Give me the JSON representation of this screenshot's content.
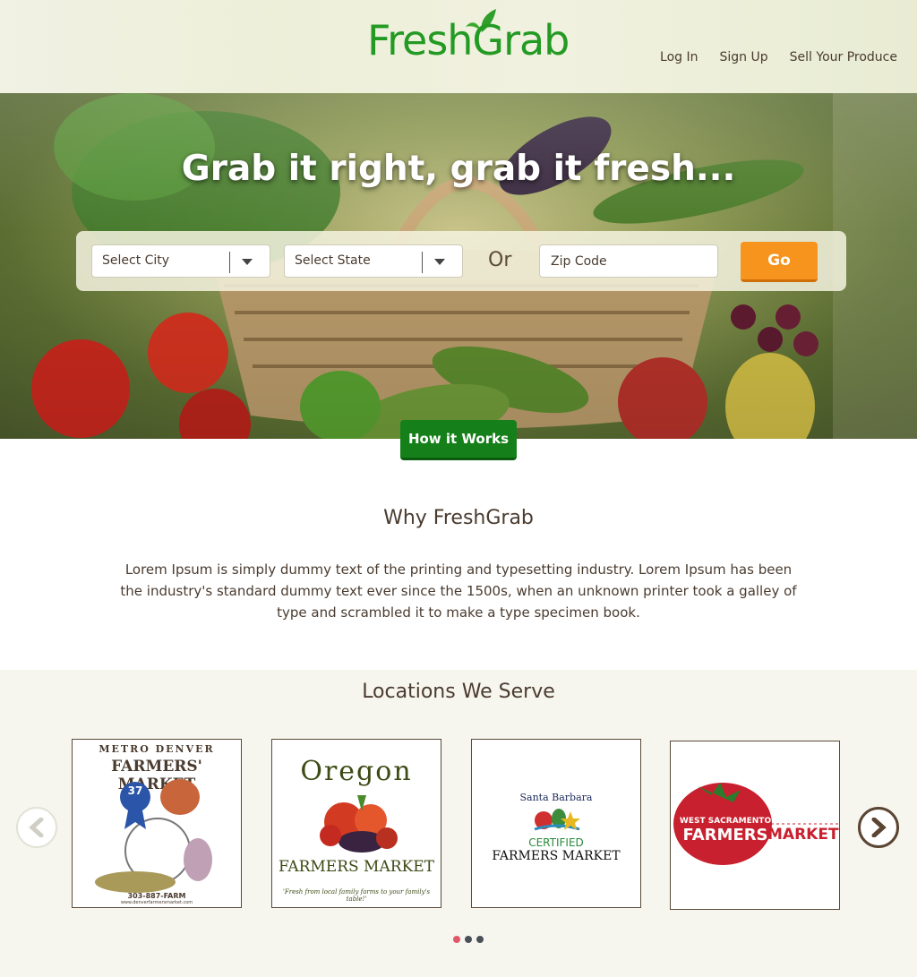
{
  "brand": {
    "logo_text": "FreshGrab",
    "color": "#239a23"
  },
  "nav": {
    "login": "Log In",
    "signup": "Sign Up",
    "sell": "Sell Your Produce"
  },
  "hero": {
    "title": "Grab it right, grab it fresh...",
    "city_select": "Select City",
    "state_select": "Select State",
    "or_text": "Or",
    "zip_placeholder": "Zip Code",
    "go_label": "Go",
    "how_label": "How it Works"
  },
  "why": {
    "title": "Why FreshGrab",
    "body": "Lorem Ipsum is simply dummy text of the printing and typesetting industry. Lorem Ipsum has been the industry's standard dummy text ever since the 1500s, when an unknown printer took a galley of type and scrambled it to make a type specimen book."
  },
  "locations": {
    "title": "Locations We Serve",
    "cards": [
      {
        "line1": "Metro Denver",
        "line2": "Farmers' Market",
        "badge": "37",
        "phone": "303-887-FARM",
        "url": "www.denverfarmersmarket.com"
      },
      {
        "line1": "Oregon",
        "line2": "Farmers Market",
        "tagline": "'Fresh from local family farms to your family's table!'"
      },
      {
        "line1": "Santa Barbara",
        "line2": "Certified",
        "line3": "Farmers Market"
      },
      {
        "line1": "West Sacramento",
        "line2": "Farmers",
        "line3": "Market"
      }
    ],
    "pagination": {
      "total": 3,
      "active": 1
    }
  },
  "colors": {
    "go": "#f7941d",
    "how": "#15801a",
    "dot_active": "#e2566a"
  }
}
